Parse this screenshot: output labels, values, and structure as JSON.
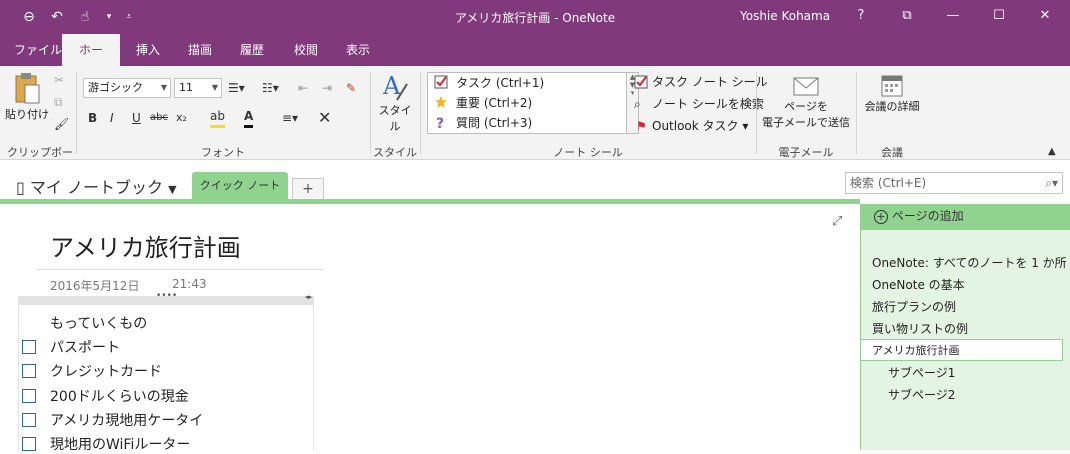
{
  "window": {
    "title": "アメリカ旅行計画 - OneNote",
    "user": "Yoshie Kohama",
    "help": "?",
    "ribbon_display": "⧉",
    "minimize": "—",
    "maximize": "☐",
    "close": "✕"
  },
  "qat": {
    "back": "⊖",
    "undo": "↶",
    "touch": "☝",
    "more": "▾",
    "customize": "⩡"
  },
  "ribbon_tabs": [
    "ファイル",
    "ホーム",
    "挿入",
    "描画",
    "履歴",
    "校閲",
    "表示"
  ],
  "ribbon": {
    "clipboard": {
      "paste": "貼り付け",
      "label": "クリップボード"
    },
    "font": {
      "family": "游ゴシック",
      "size": "11",
      "bold": "B",
      "italic": "I",
      "underline": "U",
      "strike": "abc",
      "subscript": "x₂",
      "label": "フォント"
    },
    "styles": {
      "button": "スタイル",
      "label": "スタイル"
    },
    "tags": {
      "items": [
        "タスク (Ctrl+1)",
        "重要 (Ctrl+2)",
        "質問 (Ctrl+3)"
      ],
      "todo_tag": "タスク ノート シール",
      "find_tags": "ノート シールを検索",
      "outlook": "Outlook タスク",
      "label": "ノート シール"
    },
    "email": {
      "button_line1": "ページを",
      "button_line2": "電子メールで送信",
      "label": "電子メール"
    },
    "meetings": {
      "button": "会議の詳細",
      "label": "会議"
    }
  },
  "notebook": {
    "name": "マイ ノートブック",
    "section": "クイック ノート",
    "add_section": "+",
    "search_placeholder": "検索 (Ctrl+E)"
  },
  "page": {
    "title": "アメリカ旅行計画",
    "date": "2016年5月12日",
    "time": "21:43",
    "heading": "もっていくもの",
    "todo_items": [
      "パスポート",
      "クレジットカード",
      "200ドルくらいの現金",
      "アメリカ現地用ケータイ",
      "現地用のWiFiルーター"
    ]
  },
  "page_list": {
    "add_page": "ページの追加",
    "pages": [
      {
        "label": "OneNote: すべてのノートを 1 か所",
        "sub": false
      },
      {
        "label": "OneNote の基本",
        "sub": false
      },
      {
        "label": "旅行プランの例",
        "sub": false
      },
      {
        "label": "買い物リストの例",
        "sub": false
      },
      {
        "label": "アメリカ旅行計画",
        "sub": false,
        "selected": true
      },
      {
        "label": "サブページ1",
        "sub": true
      },
      {
        "label": "サブページ2",
        "sub": true
      }
    ]
  },
  "colors": {
    "accent": "#80397b",
    "section": "#8fd38f",
    "pane": "#e3f4e3"
  }
}
